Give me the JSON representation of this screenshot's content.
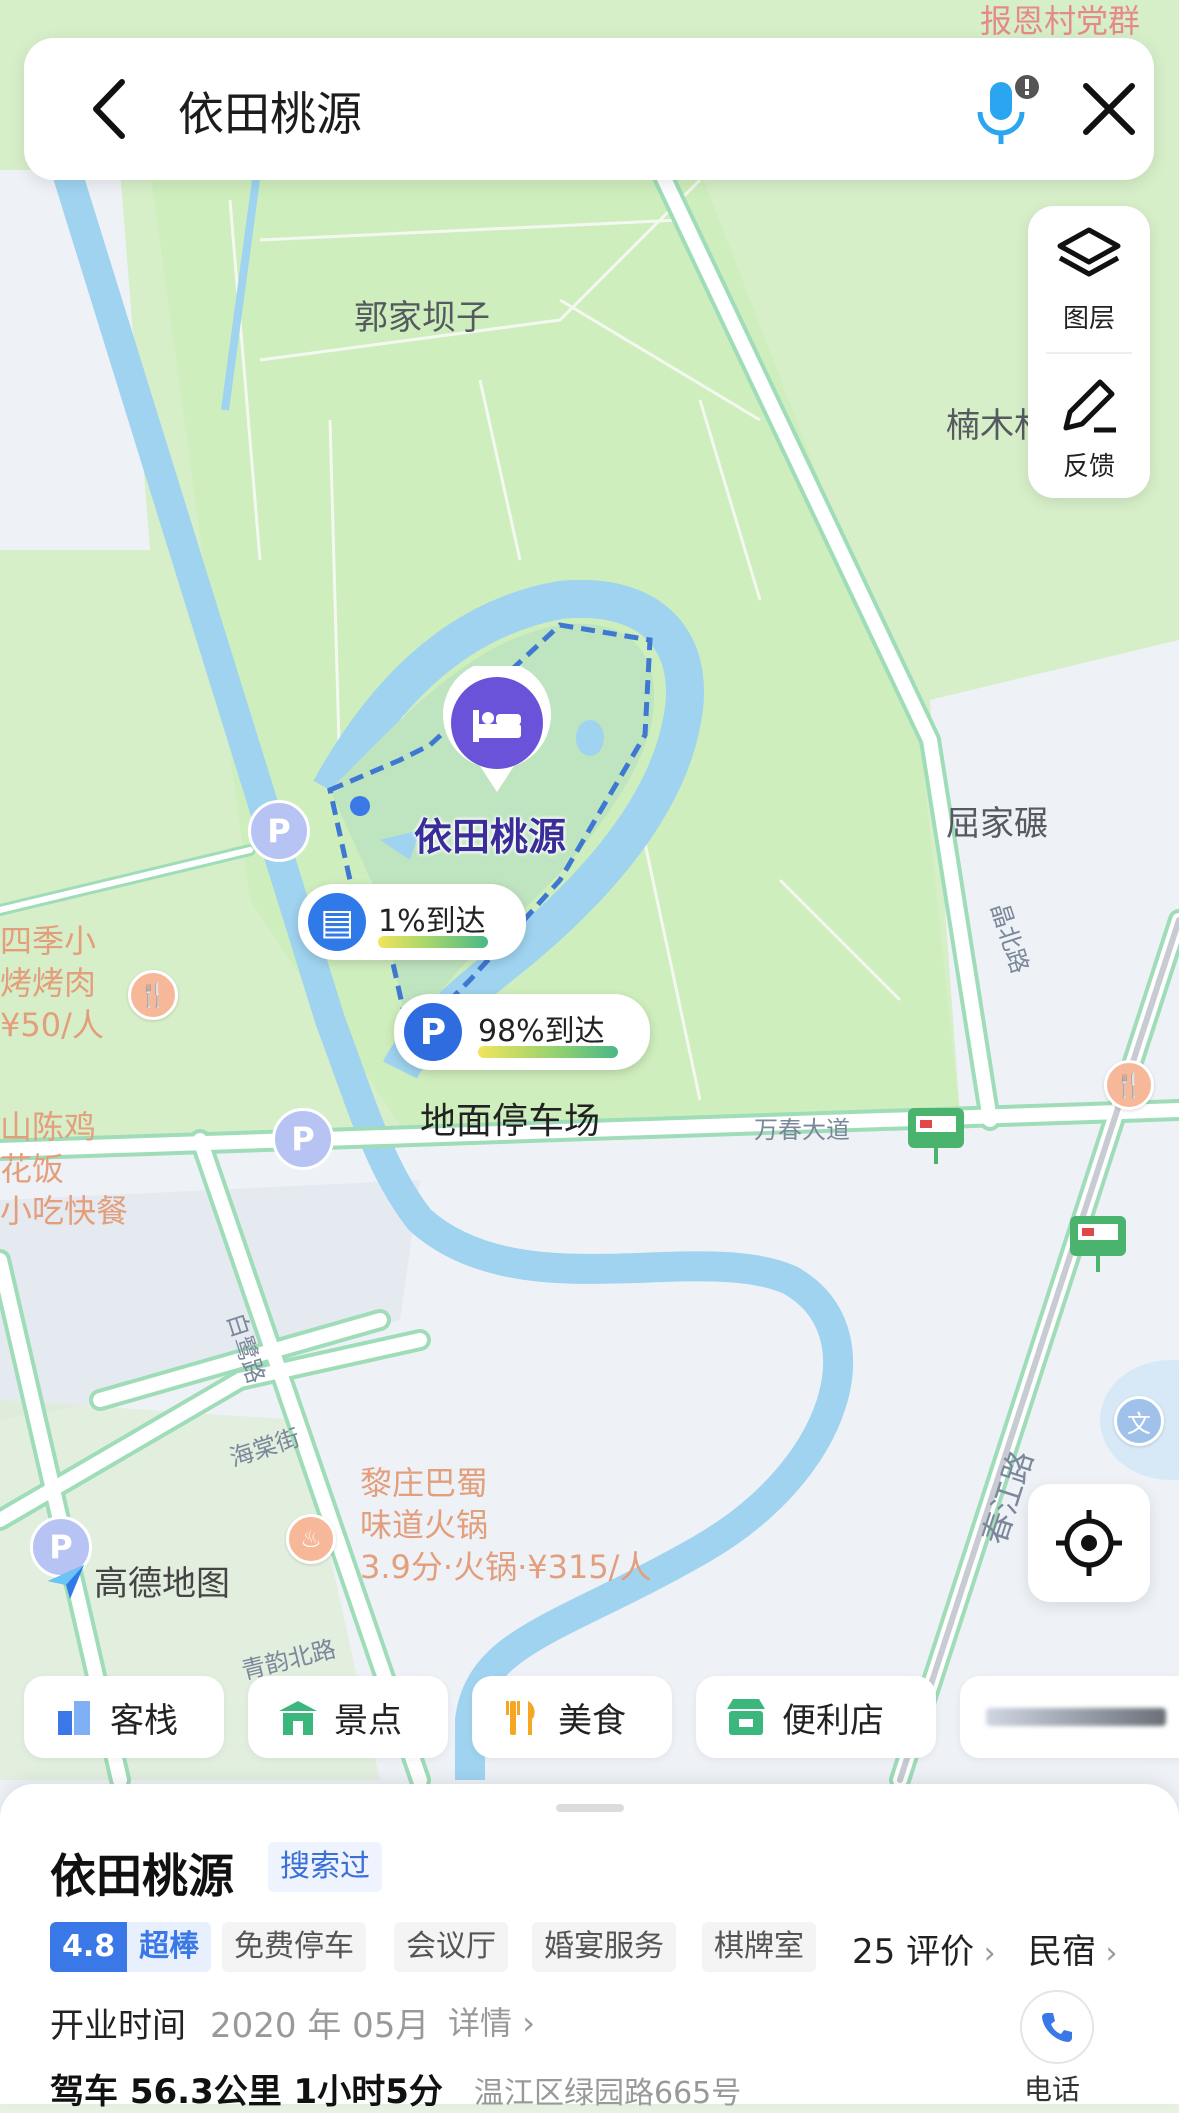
{
  "search": {
    "query": "依田桃源"
  },
  "tools": {
    "layers_label": "图层",
    "feedback_label": "反馈"
  },
  "map": {
    "place_labels": {
      "guojiabazi": "郭家坝子",
      "nanmu": "楠木林",
      "qujia": "屈家碾",
      "baoen": "报恩村党群"
    },
    "road_labels": {
      "wanchun": "万春大道",
      "jingbei": "晶北路",
      "bailu": "白鹭路",
      "haitang": "海棠街",
      "chunjiang": "春江路",
      "qinyun": "青韵北路"
    },
    "poi": {
      "bbq_line1": "四季小",
      "bbq_line2": "烤烤肉",
      "bbq_line3": "¥50/人",
      "chicken_line1": "山陈鸡",
      "chicken_line2": "花饭",
      "chicken_line3": "小吃快餐",
      "hotpot_line1": "黎庄巴蜀",
      "hotpot_line2": "味道火锅",
      "hotpot_line3": "3.9分·火锅·¥315/人",
      "culture_icon": "文"
    },
    "park_name": "依田桃源",
    "bubble_transit": "1%到达",
    "bubble_parking": "98%到达",
    "parking_label": "地面停车场",
    "parking_symbol": "P",
    "watermark": "高德地图"
  },
  "categories": [
    {
      "label": "客栈",
      "icon": "building-icon"
    },
    {
      "label": "景点",
      "icon": "gate-icon"
    },
    {
      "label": "美食",
      "icon": "fork-knife-icon"
    },
    {
      "label": "便利店",
      "icon": "shop-icon"
    }
  ],
  "sheet": {
    "title": "依田桃源",
    "searched_badge": "搜索过",
    "rating": "4.8",
    "rating_word": "超棒",
    "tags": [
      "免费停车",
      "会议厅",
      "婚宴服务",
      "棋牌室"
    ],
    "reviews": "25 评价",
    "type": "民宿",
    "hours_label": "开业时间",
    "hours_value": "2020 年 05月",
    "hours_detail": "详情",
    "drive_info": "驾车 56.3公里 1小时5分",
    "address": "温江区绿园路665号",
    "phone_label": "电话"
  },
  "colors": {
    "accent": "#3b78e7",
    "park_pin": "#6a52d9",
    "water": "#a4d8f2",
    "green": "#cfeebd",
    "road": "#9fdcb8"
  }
}
